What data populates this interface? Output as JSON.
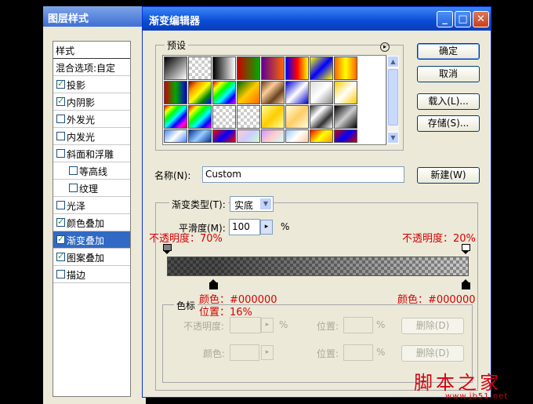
{
  "layer_style": {
    "title": "图层样式",
    "items": [
      {
        "label": "样式",
        "checkbox": false,
        "checked": false
      },
      {
        "label": "混合选项:自定",
        "checkbox": false,
        "checked": false
      },
      {
        "label": "投影",
        "checkbox": true,
        "checked": true
      },
      {
        "label": "内阴影",
        "checkbox": true,
        "checked": true
      },
      {
        "label": "外发光",
        "checkbox": true,
        "checked": false
      },
      {
        "label": "内发光",
        "checkbox": true,
        "checked": false
      },
      {
        "label": "斜面和浮雕",
        "checkbox": true,
        "checked": false
      },
      {
        "label": "等高线",
        "checkbox": true,
        "checked": false
      },
      {
        "label": "纹理",
        "checkbox": true,
        "checked": false
      },
      {
        "label": "光泽",
        "checkbox": true,
        "checked": false
      },
      {
        "label": "颜色叠加",
        "checkbox": true,
        "checked": true
      },
      {
        "label": "渐变叠加",
        "checkbox": true,
        "checked": true
      },
      {
        "label": "图案叠加",
        "checkbox": true,
        "checked": true
      },
      {
        "label": "描边",
        "checkbox": true,
        "checked": false
      }
    ]
  },
  "editor": {
    "title": "渐变编辑器",
    "window_buttons": {
      "minimize": "_",
      "maximize": "□",
      "close": "✕"
    },
    "presets_label": "预设",
    "buttons": {
      "ok": "确定",
      "cancel": "取消",
      "load": "载入(L)...",
      "save": "存储(S)...",
      "new": "新建(W)"
    },
    "name_label": "名称(N):",
    "name_value": "Custom",
    "type_label": "渐变类型(T):",
    "type_value": "实底",
    "smooth_label": "平滑度(M):",
    "smooth_value": "100",
    "smooth_unit": "%",
    "stops_group_label": "色标",
    "opacity_label": "不透明度:",
    "color_label": "颜色:",
    "location_label": "位置:",
    "percent": "%",
    "delete_label": "删除(D)"
  },
  "annotations": {
    "left_opacity": "不透明度：70%",
    "right_opacity": "不透明度：20%",
    "left_color": "颜色：#000000",
    "left_position": "位置：16%",
    "right_color": "颜色：#000000"
  },
  "gradient": {
    "opacity_stops": [
      {
        "location_percent": 0,
        "opacity_percent": 70
      },
      {
        "location_percent": 100,
        "opacity_percent": 20
      }
    ],
    "color_stops": [
      {
        "location_percent": 16,
        "color": "#000000"
      },
      {
        "location_percent": 100,
        "color": "#000000"
      }
    ]
  },
  "watermark": {
    "text": "脚本之家",
    "url": "www.jb51.net"
  },
  "colors": {
    "annotation_red": "#d40000",
    "title_blue": "#0a4bd6",
    "selected_item": "#316ac5"
  }
}
